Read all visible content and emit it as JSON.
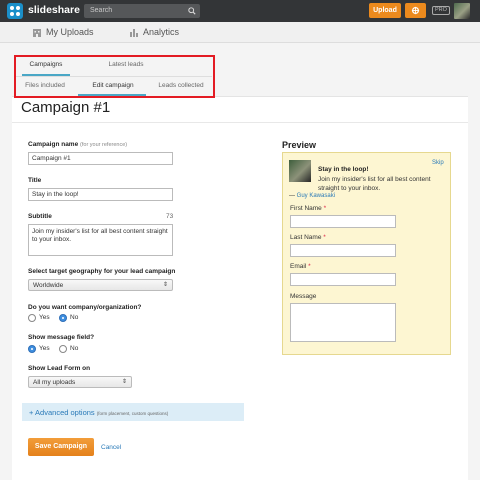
{
  "topbar": {
    "brand": "slideshare",
    "search_placeholder": "Search",
    "upload_label": "Upload",
    "pro_badge": "PRO"
  },
  "subnav": {
    "items": [
      {
        "label": "My Uploads",
        "icon": "building-icon"
      },
      {
        "label": "Analytics",
        "icon": "bar-chart-icon"
      }
    ]
  },
  "tabs": {
    "primary": [
      {
        "label": "Campaigns",
        "active": true
      },
      {
        "label": "Latest leads",
        "active": false
      }
    ],
    "secondary": [
      {
        "label": "Files included",
        "active": false
      },
      {
        "label": "Edit campaign",
        "active": true
      },
      {
        "label": "Leads collected",
        "active": false
      }
    ]
  },
  "page": {
    "title": "Campaign #1"
  },
  "form": {
    "campaign_name_label": "Campaign name",
    "campaign_name_hint": "(for your reference)",
    "campaign_name_value": "Campaign #1",
    "title_label": "Title",
    "title_value": "Stay in the loop!",
    "subtitle_label": "Subtitle",
    "subtitle_counter": "73",
    "subtitle_value": "Join my insider's list for all best content straight to your inbox.",
    "geo_label": "Select target geography for your lead campaign",
    "geo_value": "Worldwide",
    "company_label": "Do you want company/organization?",
    "company_options": [
      {
        "label": "Yes",
        "selected": false
      },
      {
        "label": "No",
        "selected": true
      }
    ],
    "message_label": "Show message field?",
    "message_options": [
      {
        "label": "Yes",
        "selected": true
      },
      {
        "label": "No",
        "selected": false
      }
    ],
    "showon_label": "Show Lead Form on",
    "showon_value": "All my uploads",
    "advanced_label": "+ Advanced options",
    "advanced_hint": "(form placement, custom questions)",
    "save_label": "Save Campaign",
    "cancel_label": "Cancel"
  },
  "preview": {
    "title": "Preview",
    "skip": "Skip",
    "headline": "Stay in the loop!",
    "body": "Join my insider's list for all best content straight to your inbox.",
    "author_dash": "—",
    "author": "Guy Kawasaki",
    "first_name_label": "First Name",
    "last_name_label": "Last Name",
    "email_label": "Email",
    "message_label": "Message",
    "required_mark": "*"
  },
  "colors": {
    "accent_orange": "#ec8a1d",
    "link_blue": "#2a7ab8",
    "tab_underline": "#4aa7c6",
    "highlight_red": "#e31b23",
    "preview_bg": "#fdf6d2"
  }
}
